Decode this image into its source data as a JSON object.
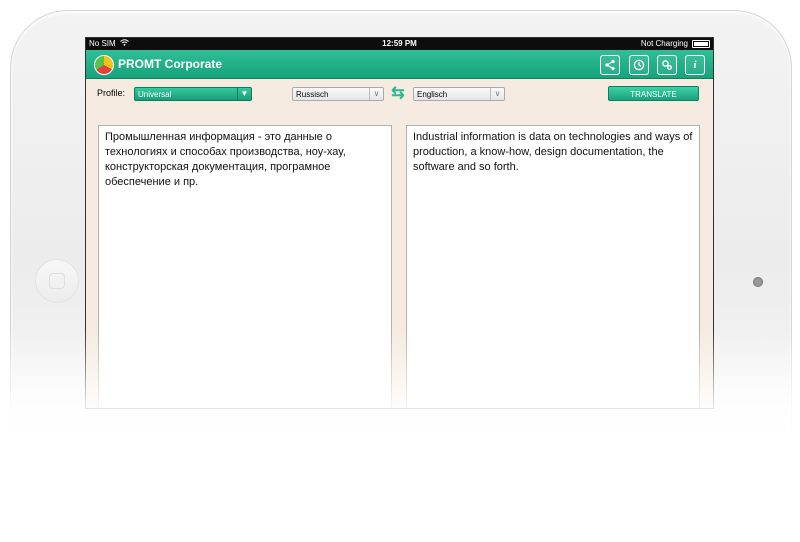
{
  "status_bar": {
    "carrier": "No SIM",
    "time": "12:59 PM",
    "battery_status": "Not Charging"
  },
  "header": {
    "title": "PROMT Corporate",
    "buttons": [
      {
        "icon": "share-icon"
      },
      {
        "icon": "history-icon"
      },
      {
        "icon": "settings-icon"
      },
      {
        "icon": "info-icon"
      }
    ]
  },
  "toolbar": {
    "profile_label": "Profile:",
    "profile_value": "Universal",
    "source_language": "Russisch",
    "target_language": "Englisch",
    "translate_label": "TRANSLATE"
  },
  "panes": {
    "source_text": "Промышленная информация - это данные о технологиях и способах производства, ноу-хау, конструкторская документация, програмное обеспечение и пр.",
    "target_text": "Industrial information is data on technologies and ways of production, a know-how, design documentation, the software and so forth."
  },
  "colors": {
    "accent": "#1fb088",
    "background": "#f5ebe0"
  }
}
